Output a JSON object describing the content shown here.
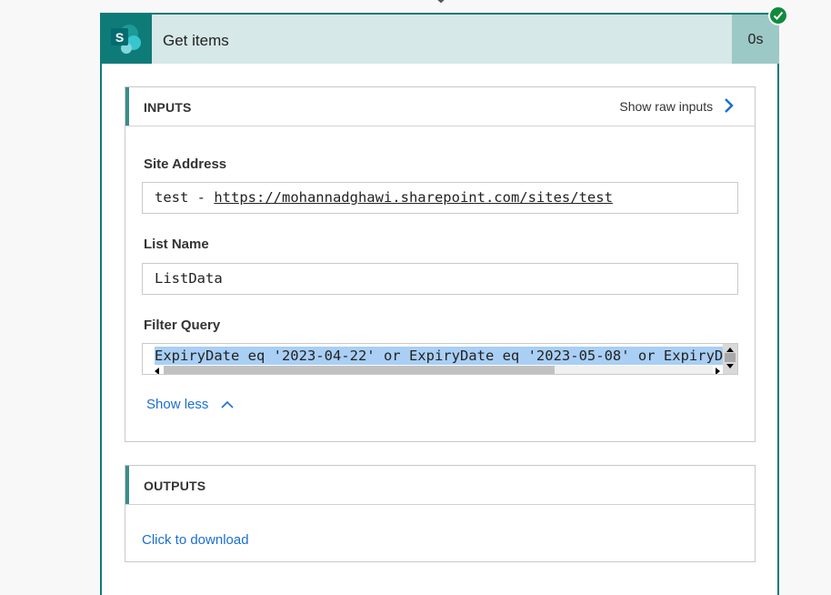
{
  "action": {
    "title": "Get items",
    "duration": "0s",
    "icon": "sharepoint-icon",
    "brand_color": "#0f7b78",
    "status": "succeeded"
  },
  "inputs": {
    "section_label": "INPUTS",
    "raw_link": "Show raw inputs",
    "fields": [
      {
        "label": "Site Address",
        "value_prefix": "test - ",
        "value_link": "https://mohannadghawi.sharepoint.com/sites/test"
      },
      {
        "label": "List Name",
        "value": "ListData"
      },
      {
        "label": "Filter Query",
        "value": "ExpiryDate eq '2023-04-22' or ExpiryDate eq '2023-05-08' or ExpiryD"
      }
    ],
    "show_less": "Show less"
  },
  "outputs": {
    "section_label": "OUTPUTS",
    "download_link": "Click to download"
  }
}
